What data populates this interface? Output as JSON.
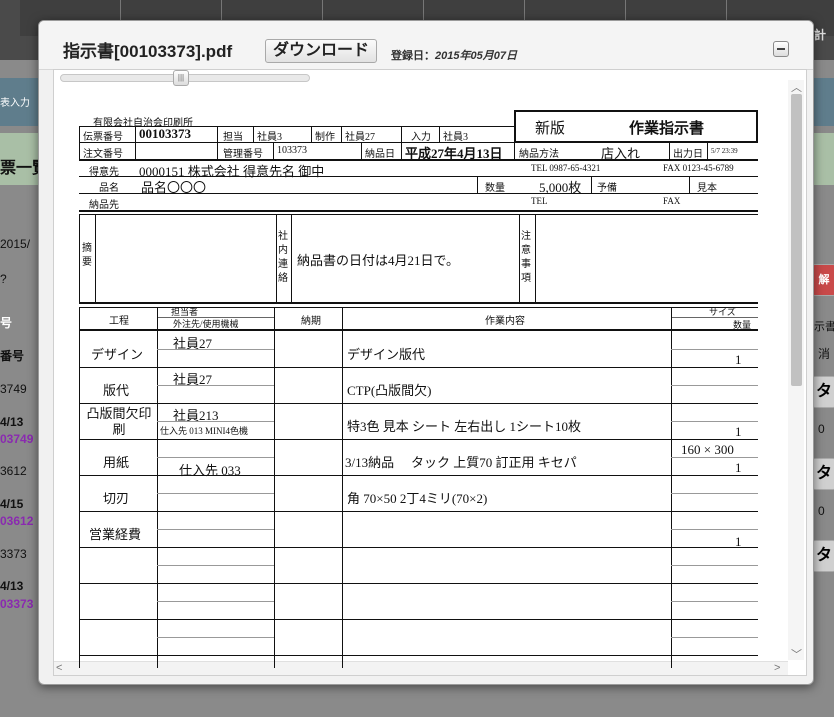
{
  "background": {
    "sidebar_labels": [
      "表入力",
      "票一覧",
      "2015/",
      "?",
      "号",
      "番号",
      "3749",
      "4/13",
      "03749",
      "3612",
      "4/15",
      "03612",
      "3373",
      "4/13",
      "03373"
    ],
    "right_labels": [
      "計",
      "解",
      "示書?",
      "消",
      "タ",
      "0",
      "タ",
      "0",
      "タ"
    ]
  },
  "modal": {
    "title": "指示書[00103373].pdf",
    "download_label": "ダウンロード",
    "registered_label": "登録日：",
    "registered_date": "2015年05月07日"
  },
  "document": {
    "company": "有限会社自治会印刷所",
    "slip_no_label": "伝票番号",
    "slip_no": "00103373",
    "tanto_label": "担当",
    "tanto": "社員3",
    "seisaku_label": "制作",
    "seisaku": "社員27",
    "nyuryoku_label": "入力",
    "nyuryoku": "社員3",
    "version": "新版",
    "doc_title": "作業指示書",
    "order_no_label": "注文番号",
    "kanri_label": "管理番号",
    "kanri": "103373",
    "delivery_label": "納品日",
    "delivery_date": "平成27年4月13日",
    "method_label": "納品方法",
    "method": "店入れ",
    "output_label": "出力日",
    "output_date": "5/7 23:39",
    "customer_label": "得意先",
    "customer": "0000151 株式会社 得意先名 御中",
    "tel1": "TEL 0987-65-4321",
    "fax1": "FAX 0123-45-6789",
    "product_label": "品名",
    "product": "品名〇〇〇",
    "qty_label": "数量",
    "qty": "5,000枚",
    "spare_label": "予備",
    "sample_label": "見本",
    "dest_label": "納品先",
    "tel2": "TEL",
    "fax2": "FAX",
    "summary_label": "摘要",
    "internal_label": "社内連絡",
    "internal_note": "納品書の日付は4月21日で。",
    "caution_label": "注意事項",
    "table_headers": {
      "process": "工程",
      "person": "担当者",
      "vendor": "外注先/使用機械",
      "deadline": "納期",
      "content": "作業内容",
      "size": "サイズ",
      "qty": "数量"
    },
    "rows": [
      {
        "process": "デザイン",
        "person": "社員27",
        "vendor": "",
        "deadline": "",
        "content": "デザイン版代",
        "size": "",
        "qty": "1"
      },
      {
        "process": "版代",
        "person": "社員27",
        "vendor": "",
        "deadline": "",
        "content": "CTP(凸版間欠)",
        "size": "",
        "qty": ""
      },
      {
        "process": "凸版間欠印刷",
        "person": "社員213",
        "vendor": "仕入先 013 MINI4色機",
        "deadline": "",
        "content": "特3色 見本 シート 左右出し 1シート10枚",
        "size": "",
        "qty": "1"
      },
      {
        "process": "用紙",
        "person": "",
        "vendor": "仕入先 033",
        "deadline": "3/13納品",
        "content": "タック 上質70 訂正用 キセパ",
        "size": "160 × 300",
        "qty": "1"
      },
      {
        "process": "切刃",
        "person": "",
        "vendor": "",
        "deadline": "",
        "content": "角 70×50 2丁4ミリ(70×2)",
        "size": "",
        "qty": ""
      },
      {
        "process": "営業経費",
        "person": "",
        "vendor": "",
        "deadline": "",
        "content": "",
        "size": "",
        "qty": "1"
      }
    ]
  }
}
